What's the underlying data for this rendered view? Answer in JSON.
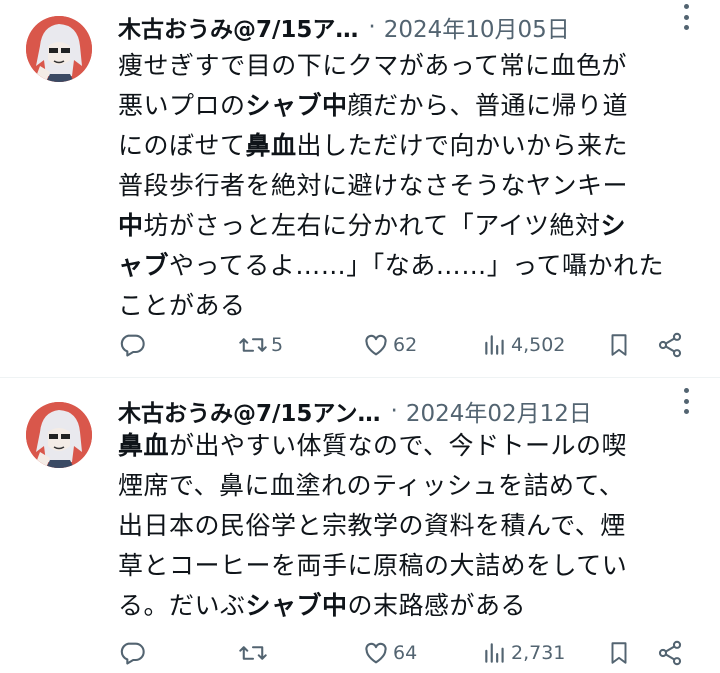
{
  "tweets": [
    {
      "author_name": "木古おうみ@7/15ア…",
      "separator": "·",
      "date": "2024年10月05日",
      "body_segments": [
        [
          {
            "t": "痩せぎすで目の下にクマがあって常に血色が",
            "b": false
          }
        ],
        [
          {
            "t": "悪いプロの",
            "b": false
          },
          {
            "t": "シャブ中",
            "b": true
          },
          {
            "t": "顔だから、普通に帰り道",
            "b": false
          }
        ],
        [
          {
            "t": "にのぼせて",
            "b": false
          },
          {
            "t": "鼻血",
            "b": true
          },
          {
            "t": "出しただけで向かいから来た",
            "b": false
          }
        ],
        [
          {
            "t": "普段歩行者を絶対に避けなさそうなヤンキー",
            "b": false
          }
        ],
        [
          {
            "t": "中",
            "b": true
          },
          {
            "t": "坊がさっと左右に分かれて「アイツ絶対",
            "b": false
          },
          {
            "t": "シ",
            "b": true
          }
        ],
        [
          {
            "t": "ャブ",
            "b": true
          },
          {
            "t": "やってるよ……」「なあ……」って囁かれた",
            "b": false
          }
        ],
        [
          {
            "t": "ことがある",
            "b": false
          }
        ]
      ],
      "actions": {
        "replies": "",
        "reposts": "5",
        "likes": "62",
        "views": "4,502"
      }
    },
    {
      "author_name": "木古おうみ@7/15アン…",
      "separator": "·",
      "date": "2024年02月12日",
      "body_segments": [
        [
          {
            "t": "鼻血",
            "b": true
          },
          {
            "t": "が出やすい体質なので、今ドトールの喫",
            "b": false
          }
        ],
        [
          {
            "t": "煙席で、鼻に血塗れのティッシュを詰めて、",
            "b": false
          }
        ],
        [
          {
            "t": "出日本の民俗学と宗教学の資料を積んで、煙",
            "b": false
          }
        ],
        [
          {
            "t": "草とコーヒーを両手に原稿の大詰めをしてい",
            "b": false
          }
        ],
        [
          {
            "t": "る。だいぶ",
            "b": false
          },
          {
            "t": "シャブ中",
            "b": true
          },
          {
            "t": "の末路感がある",
            "b": false
          }
        ]
      ],
      "actions": {
        "replies": "",
        "reposts": "",
        "likes": "64",
        "views": "2,731"
      }
    }
  ],
  "colors": {
    "text": "#0f1419",
    "secondary": "#536471",
    "divider": "#eff3f4",
    "avatar_bg": "#d9574b"
  },
  "icons": [
    "reply-icon",
    "repost-icon",
    "like-icon",
    "views-icon",
    "bookmark-icon",
    "share-icon",
    "more-icon"
  ]
}
